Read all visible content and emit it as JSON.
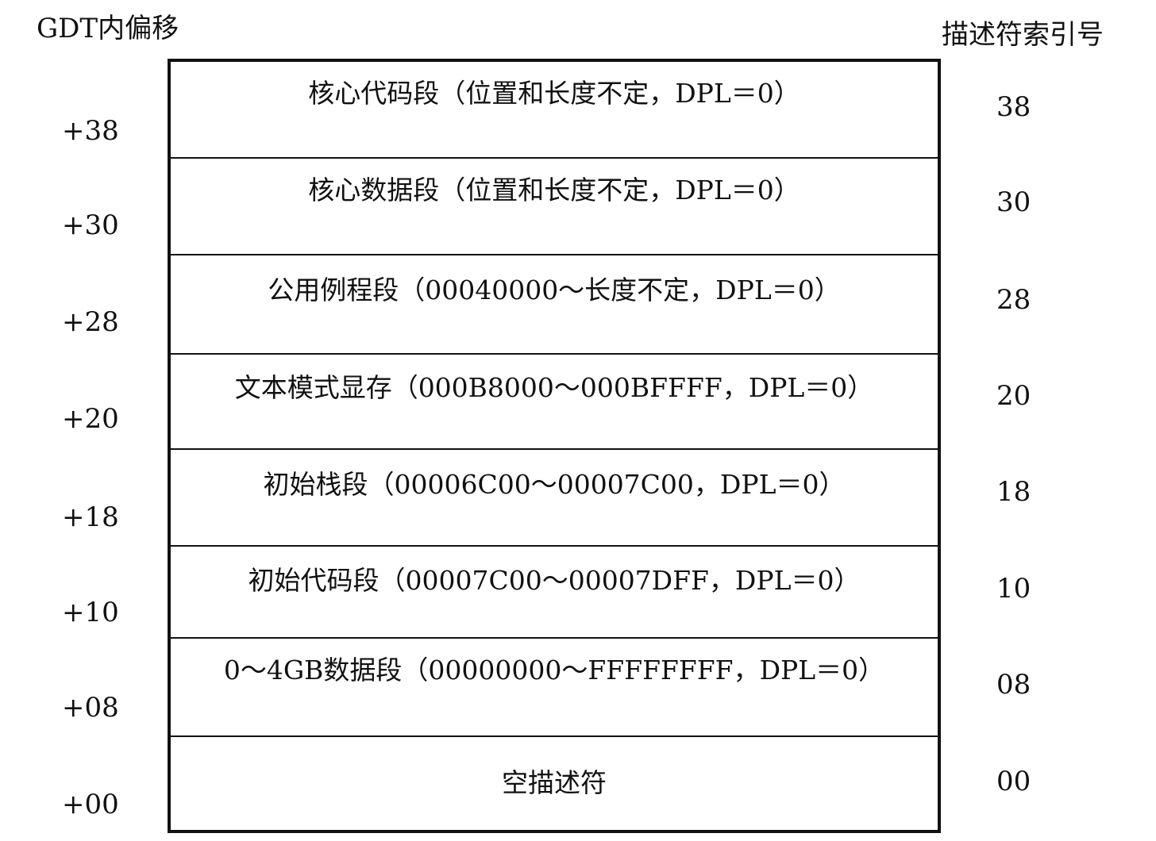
{
  "header": {
    "offset_label": "GDT内偏移",
    "index_label": "描述符索引号"
  },
  "rows": [
    {
      "offset": "+38",
      "label": "核心代码段（位置和长度不定，DPL＝0）",
      "index": "38"
    },
    {
      "offset": "+30",
      "label": "核心数据段（位置和长度不定，DPL＝0）",
      "index": "30"
    },
    {
      "offset": "+28",
      "label": "公用例程段（00040000～长度不定，DPL＝0）",
      "index": "28"
    },
    {
      "offset": "+20",
      "label": "文本模式显存（000B8000～000BFFFF，DPL＝0）",
      "index": "20"
    },
    {
      "offset": "+18",
      "label": "初始栈段（00006C00～00007C00，DPL＝0）",
      "index": "18"
    },
    {
      "offset": "+10",
      "label": "初始代码段（00007C00～00007DFF，DPL＝0）",
      "index": "10"
    },
    {
      "offset": "+08",
      "label": "0～4GB数据段（00000000～FFFFFFFF，DPL＝0）",
      "index": "08"
    },
    {
      "offset": "+00",
      "label": "空描述符",
      "index": "00"
    }
  ]
}
